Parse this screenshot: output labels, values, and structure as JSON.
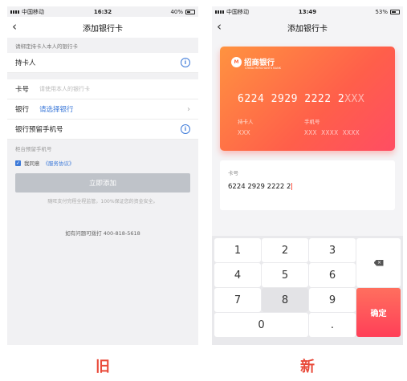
{
  "old_screen": {
    "status": {
      "carrier": "中国移动",
      "time": "16:32",
      "battery": "40%",
      "battery_level": 0.4
    },
    "title": "添加银行卡",
    "hint": "请绑定持卡人本人的银行卡",
    "holder_label": "持卡人",
    "card_no_label": "卡号",
    "card_no_placeholder": "请使用本人的银行卡",
    "bank_label": "银行",
    "bank_value": "请选择银行",
    "phone_label": "银行预留手机号",
    "counter_note": "柜台预留手机号",
    "agree_text": "我同意",
    "agreement_link": "《服务协议》",
    "submit_label": "立即添加",
    "security_note": "随旺支付完程全程监管，100%保证您的资金安全。",
    "hotline": "如有问题可拨打 400-818-5618",
    "caption": "旧"
  },
  "new_screen": {
    "status": {
      "carrier": "中国移动",
      "time": "13:49",
      "battery": "53%",
      "battery_level": 0.53
    },
    "title": "添加银行卡",
    "card": {
      "bank_name": "招商银行",
      "bank_english": "CHINA MERCHANTS BANK",
      "logo_mark": "M",
      "number_entered": "6224 2929 2222 2",
      "number_masked": "XXX",
      "holder_label": "持卡人",
      "holder_value": "XXX",
      "phone_label": "手机号",
      "phone_value": "XXX XXXX XXXX"
    },
    "input_label": "卡号",
    "input_value": "6224 2929 2222 2",
    "keys": [
      "1",
      "2",
      "3",
      "4",
      "5",
      "6",
      "7",
      "8",
      "9",
      "0",
      "."
    ],
    "confirm_label": "确定",
    "delete_glyph": "×",
    "caption": "新"
  },
  "icons": {
    "back": "‹",
    "info": "i",
    "chevron": "›",
    "check": "✓"
  },
  "colors": {
    "accent_blue": "#3d7ad9",
    "card_gradient_start": "#ff9340",
    "card_gradient_end": "#ff4d63",
    "caption_red": "#e94a3a"
  }
}
